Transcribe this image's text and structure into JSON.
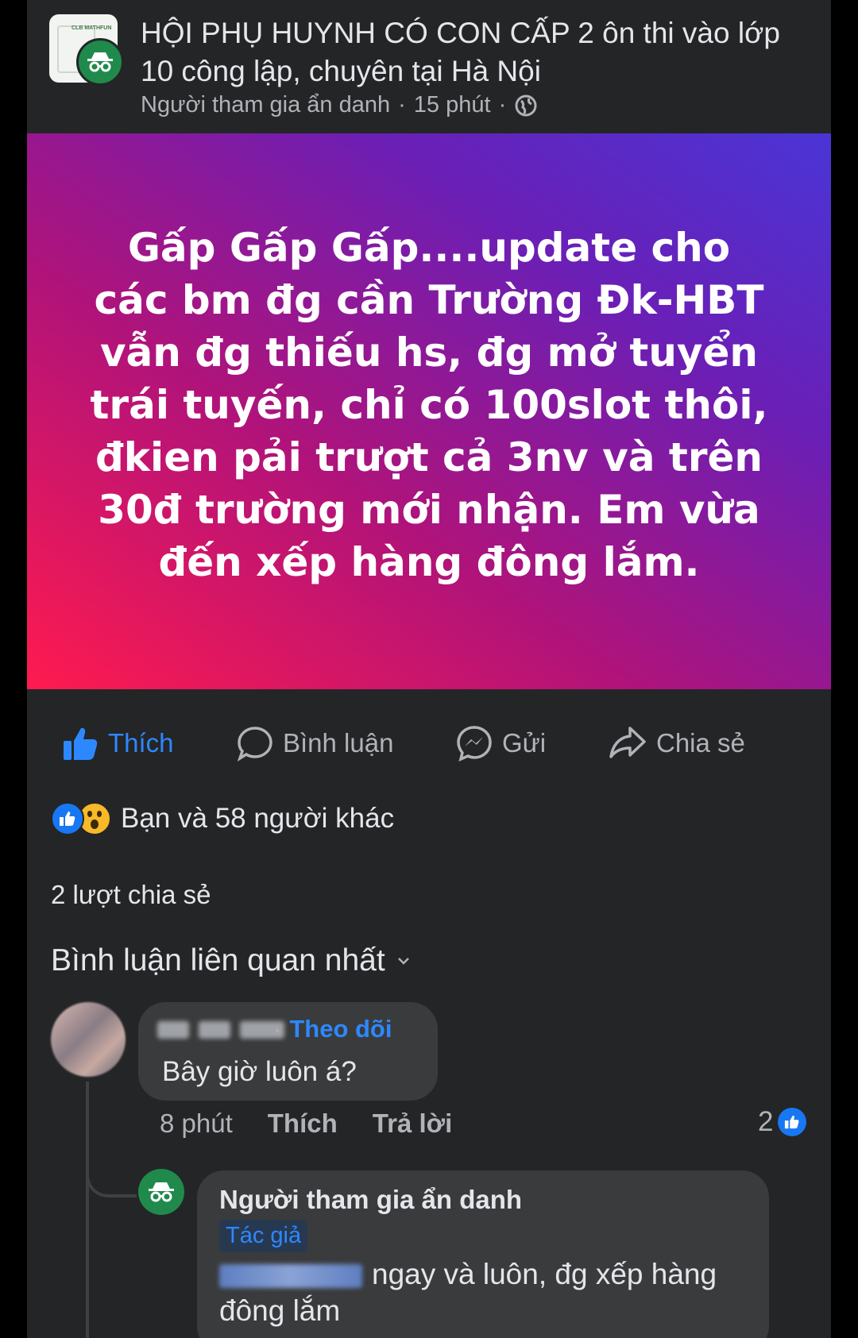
{
  "post": {
    "group_title": "HỘI PHỤ HUYNH CÓ CON CẤP 2 ôn thi vào lớp 10 công lập, chuyên tại Hà Nội",
    "author": "Người tham gia ẩn danh",
    "separator": "·",
    "time": "15 phút",
    "group_avatar_text": "CLB MATHFUN",
    "banner_text": "Gấp Gấp Gấp....update cho các bm đg cần Trường Đk-HBT vẫn đg thiếu hs, đg mở tuyển trái tuyến, chỉ có 100slot thôi, đkien pải trượt cả 3nv và trên 30đ trường mới nhận. Em vừa đến xếp hàng đông lắm.",
    "banner_gradient": [
      "#ff1a4f",
      "#b0137a",
      "#6a1fb6",
      "#4a35d6"
    ]
  },
  "actions": {
    "like": "Thích",
    "comment": "Bình luận",
    "send": "Gửi",
    "share": "Chia sẻ",
    "like_active": true,
    "accent_color": "#2d88ff"
  },
  "reactions": {
    "summary": "Bạn và 58 người khác",
    "icons": [
      "like-icon",
      "wow-icon"
    ]
  },
  "shares_text": "2 lượt chia sẻ",
  "comments_sort": "Bình luận liên quan nhất",
  "comments": [
    {
      "follow": "Theo dõi",
      "text": "Bây giờ luôn á?",
      "time": "8 phút",
      "like": "Thích",
      "reply": "Trả lời",
      "reaction_count": "2",
      "replies": [
        {
          "author": "Người tham gia ẩn danh",
          "badge": "Tác giả",
          "text": "ngay và luôn, đg xếp hàng đông lắm"
        }
      ]
    }
  ]
}
